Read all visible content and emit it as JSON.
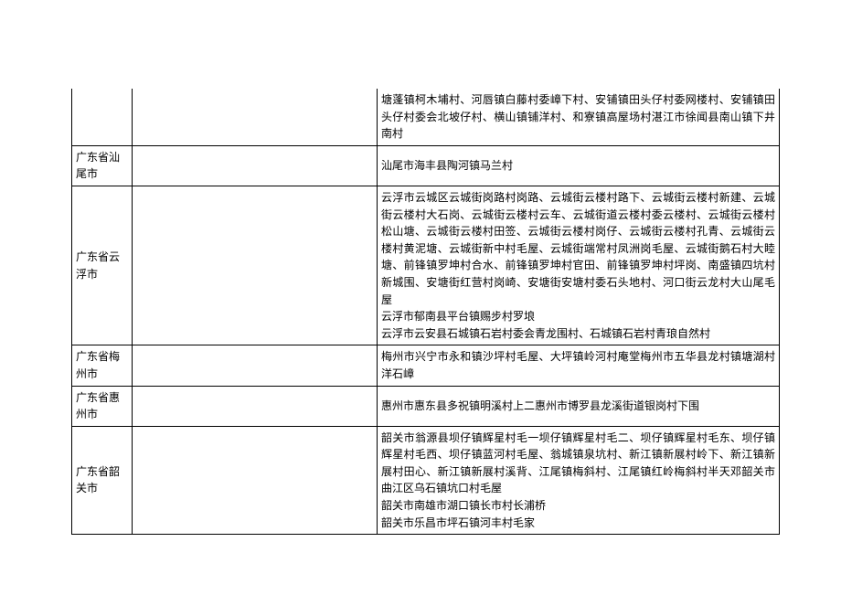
{
  "rows": [
    {
      "region": "",
      "mid": "",
      "content": "塘蓬镇柯木埔村、河唇镇白藤村委嶂下村、安铺镇田头仔村委网楼村、安铺镇田头仔村委会北坡仔村、横山镇铺洋村、和寮镇高屋场村湛江市徐闻县南山镇下井南村"
    },
    {
      "region": "广东省汕尾市",
      "mid": "",
      "content": "汕尾市海丰县陶河镇马兰村"
    },
    {
      "region": "广东省云浮市",
      "mid": "",
      "content": "云浮市云城区云城街岗路村岗路、云城街云楼村路下、云城街云楼村新建、云城街云楼村大石岗、云城街云楼村云车、云城街道云楼村委云楼村、云城街云楼村松山塘、云城街云楼村田签、云城街云楼村岗仔、云城街云楼村孔青、云城街云楼村黄泥塘、云城街新中村毛屋、云城街端常村凤洲岗毛屋、云城街鹅石村大睦塘、前锋镇罗坤村合水、前锋镇罗坤村官田、前锋镇罗坤村坪岗、南盛镇四坑村新城围、安塘街红营村岗崎、安塘街安塘村委石头地村、河口街云龙村大山尾毛屋\n云浮市郁南县平台镇赐步村罗埌\n云浮市云安县石城镇石岩村委会青龙围村、石城镇石岩村青琅自然村"
    },
    {
      "region": "广东省梅州市",
      "mid": "",
      "content": "梅州市兴宁市永和镇沙坪村毛屋、大坪镇岭河村庵堂梅州市五华县龙村镇塘湖村洋石嶂"
    },
    {
      "region": "广东省惠州市",
      "mid": "",
      "content": "惠州市惠东县多祝镇明溪村上二惠州市博罗县龙溪街道银岗村下围"
    },
    {
      "region": "广东省韶关市",
      "mid": "",
      "content": "韶关市翁源县坝仔镇辉星村毛一坝仔镇辉星村毛二、坝仔镇辉星村毛东、坝仔镇辉星村毛西、坝仔镇蓝河村毛屋、翁城镇泉坑村、新江镇新展村岭下、新江镇新展村田心、新江镇新展村溪背、江尾镇梅斜村、江尾镇红岭梅斜村半天邓韶关市曲江区乌石镇坑口村毛屋\n韶关市南雄市湖口镇长市村长浦桥\n韶关市乐昌市坪石镇河丰村毛家"
    }
  ]
}
